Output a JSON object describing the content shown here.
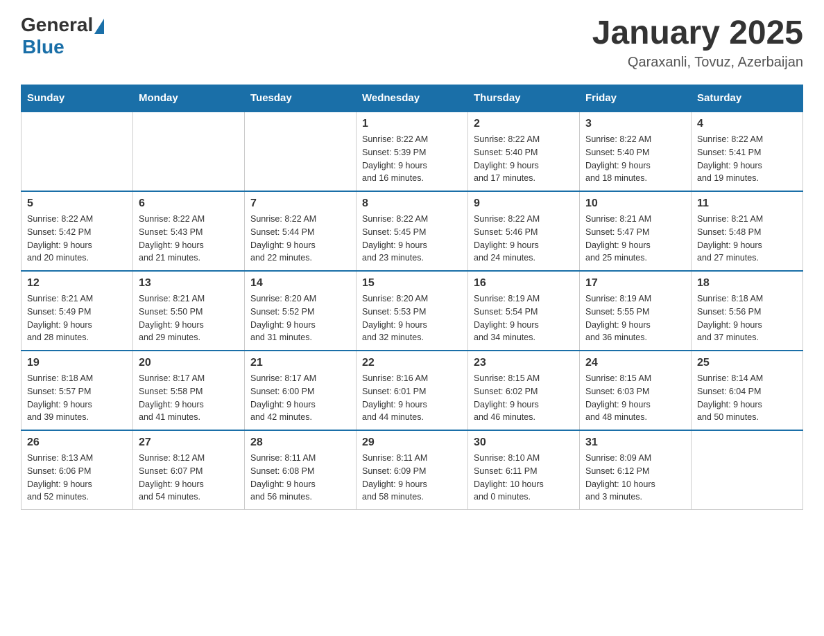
{
  "logo": {
    "general": "General",
    "blue": "Blue"
  },
  "title": "January 2025",
  "location": "Qaraxanli, Tovuz, Azerbaijan",
  "weekdays": [
    "Sunday",
    "Monday",
    "Tuesday",
    "Wednesday",
    "Thursday",
    "Friday",
    "Saturday"
  ],
  "weeks": [
    [
      {
        "day": "",
        "info": ""
      },
      {
        "day": "",
        "info": ""
      },
      {
        "day": "",
        "info": ""
      },
      {
        "day": "1",
        "info": "Sunrise: 8:22 AM\nSunset: 5:39 PM\nDaylight: 9 hours\nand 16 minutes."
      },
      {
        "day": "2",
        "info": "Sunrise: 8:22 AM\nSunset: 5:40 PM\nDaylight: 9 hours\nand 17 minutes."
      },
      {
        "day": "3",
        "info": "Sunrise: 8:22 AM\nSunset: 5:40 PM\nDaylight: 9 hours\nand 18 minutes."
      },
      {
        "day": "4",
        "info": "Sunrise: 8:22 AM\nSunset: 5:41 PM\nDaylight: 9 hours\nand 19 minutes."
      }
    ],
    [
      {
        "day": "5",
        "info": "Sunrise: 8:22 AM\nSunset: 5:42 PM\nDaylight: 9 hours\nand 20 minutes."
      },
      {
        "day": "6",
        "info": "Sunrise: 8:22 AM\nSunset: 5:43 PM\nDaylight: 9 hours\nand 21 minutes."
      },
      {
        "day": "7",
        "info": "Sunrise: 8:22 AM\nSunset: 5:44 PM\nDaylight: 9 hours\nand 22 minutes."
      },
      {
        "day": "8",
        "info": "Sunrise: 8:22 AM\nSunset: 5:45 PM\nDaylight: 9 hours\nand 23 minutes."
      },
      {
        "day": "9",
        "info": "Sunrise: 8:22 AM\nSunset: 5:46 PM\nDaylight: 9 hours\nand 24 minutes."
      },
      {
        "day": "10",
        "info": "Sunrise: 8:21 AM\nSunset: 5:47 PM\nDaylight: 9 hours\nand 25 minutes."
      },
      {
        "day": "11",
        "info": "Sunrise: 8:21 AM\nSunset: 5:48 PM\nDaylight: 9 hours\nand 27 minutes."
      }
    ],
    [
      {
        "day": "12",
        "info": "Sunrise: 8:21 AM\nSunset: 5:49 PM\nDaylight: 9 hours\nand 28 minutes."
      },
      {
        "day": "13",
        "info": "Sunrise: 8:21 AM\nSunset: 5:50 PM\nDaylight: 9 hours\nand 29 minutes."
      },
      {
        "day": "14",
        "info": "Sunrise: 8:20 AM\nSunset: 5:52 PM\nDaylight: 9 hours\nand 31 minutes."
      },
      {
        "day": "15",
        "info": "Sunrise: 8:20 AM\nSunset: 5:53 PM\nDaylight: 9 hours\nand 32 minutes."
      },
      {
        "day": "16",
        "info": "Sunrise: 8:19 AM\nSunset: 5:54 PM\nDaylight: 9 hours\nand 34 minutes."
      },
      {
        "day": "17",
        "info": "Sunrise: 8:19 AM\nSunset: 5:55 PM\nDaylight: 9 hours\nand 36 minutes."
      },
      {
        "day": "18",
        "info": "Sunrise: 8:18 AM\nSunset: 5:56 PM\nDaylight: 9 hours\nand 37 minutes."
      }
    ],
    [
      {
        "day": "19",
        "info": "Sunrise: 8:18 AM\nSunset: 5:57 PM\nDaylight: 9 hours\nand 39 minutes."
      },
      {
        "day": "20",
        "info": "Sunrise: 8:17 AM\nSunset: 5:58 PM\nDaylight: 9 hours\nand 41 minutes."
      },
      {
        "day": "21",
        "info": "Sunrise: 8:17 AM\nSunset: 6:00 PM\nDaylight: 9 hours\nand 42 minutes."
      },
      {
        "day": "22",
        "info": "Sunrise: 8:16 AM\nSunset: 6:01 PM\nDaylight: 9 hours\nand 44 minutes."
      },
      {
        "day": "23",
        "info": "Sunrise: 8:15 AM\nSunset: 6:02 PM\nDaylight: 9 hours\nand 46 minutes."
      },
      {
        "day": "24",
        "info": "Sunrise: 8:15 AM\nSunset: 6:03 PM\nDaylight: 9 hours\nand 48 minutes."
      },
      {
        "day": "25",
        "info": "Sunrise: 8:14 AM\nSunset: 6:04 PM\nDaylight: 9 hours\nand 50 minutes."
      }
    ],
    [
      {
        "day": "26",
        "info": "Sunrise: 8:13 AM\nSunset: 6:06 PM\nDaylight: 9 hours\nand 52 minutes."
      },
      {
        "day": "27",
        "info": "Sunrise: 8:12 AM\nSunset: 6:07 PM\nDaylight: 9 hours\nand 54 minutes."
      },
      {
        "day": "28",
        "info": "Sunrise: 8:11 AM\nSunset: 6:08 PM\nDaylight: 9 hours\nand 56 minutes."
      },
      {
        "day": "29",
        "info": "Sunrise: 8:11 AM\nSunset: 6:09 PM\nDaylight: 9 hours\nand 58 minutes."
      },
      {
        "day": "30",
        "info": "Sunrise: 8:10 AM\nSunset: 6:11 PM\nDaylight: 10 hours\nand 0 minutes."
      },
      {
        "day": "31",
        "info": "Sunrise: 8:09 AM\nSunset: 6:12 PM\nDaylight: 10 hours\nand 3 minutes."
      },
      {
        "day": "",
        "info": ""
      }
    ]
  ]
}
